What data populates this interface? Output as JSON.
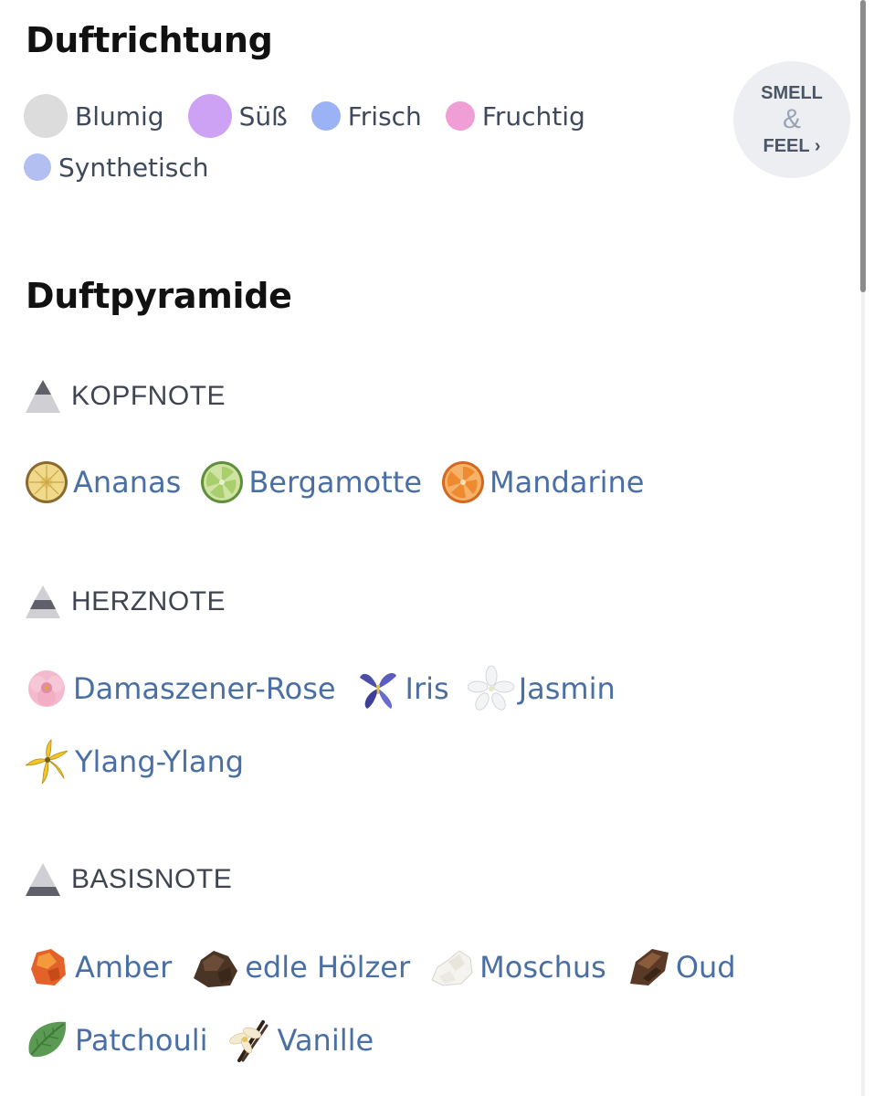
{
  "duftrichtung": {
    "title": "Duftrichtung",
    "families": [
      {
        "label": "Blumig",
        "color": "#dcdcdc"
      },
      {
        "label": "Süß",
        "color": "#cda2f4"
      },
      {
        "label": "Frisch",
        "color": "#9bb3f4"
      },
      {
        "label": "Fruchtig",
        "color": "#ef9ed6"
      },
      {
        "label": "Synthetisch",
        "color": "#b3bff0"
      }
    ],
    "smell_feel": {
      "line1": "SMELL",
      "amp": "&",
      "line2": "FEEL",
      "arrow": "›"
    }
  },
  "duftpyramide": {
    "title": "Duftpyramide",
    "kopfnote": {
      "label": "KOPFNOTE",
      "items": [
        {
          "label": "Ananas",
          "icon": "pineapple-slice-icon"
        },
        {
          "label": "Bergamotte",
          "icon": "bergamot-slice-icon"
        },
        {
          "label": "Mandarine",
          "icon": "mandarin-slice-icon"
        }
      ]
    },
    "herznote": {
      "label": "HERZNOTE",
      "items": [
        {
          "label": "Damaszener-Rose",
          "icon": "rose-icon"
        },
        {
          "label": "Iris",
          "icon": "iris-flower-icon"
        },
        {
          "label": "Jasmin",
          "icon": "jasmine-flower-icon"
        },
        {
          "label": "Ylang-Ylang",
          "icon": "ylang-ylang-flower-icon"
        }
      ]
    },
    "basisnote": {
      "label": "BASISNOTE",
      "items": [
        {
          "label": "Amber",
          "icon": "amber-stone-icon"
        },
        {
          "label": "edle Hölzer",
          "icon": "wood-chunk-icon"
        },
        {
          "label": "Moschus",
          "icon": "musk-crystal-icon"
        },
        {
          "label": "Oud",
          "icon": "oud-wood-icon"
        },
        {
          "label": "Patchouli",
          "icon": "patchouli-leaf-icon"
        },
        {
          "label": "Vanille",
          "icon": "vanilla-flower-icon"
        }
      ]
    }
  }
}
